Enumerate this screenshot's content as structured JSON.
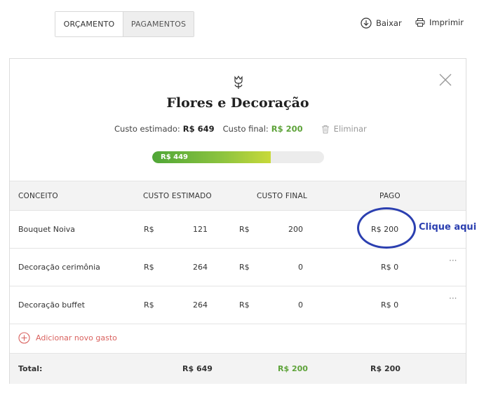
{
  "tabs": [
    {
      "label": "ORÇAMENTO",
      "active": true
    },
    {
      "label": "PAGAMENTOS",
      "active": false
    }
  ],
  "actions": {
    "download": "Baixar",
    "print": "Imprimir"
  },
  "category": {
    "title": "Flores e Decoração",
    "icon": "flower-icon",
    "estimated_label": "Custo estimado:",
    "estimated_value": "R$ 649",
    "final_label": "Custo final:",
    "final_value": "R$ 200",
    "delete_label": "Eliminar",
    "progress_label": "R$ 449",
    "progress_fraction": 0.69
  },
  "table": {
    "headers": [
      "CONCEITO",
      "CUSTO ESTIMADO",
      "CUSTO FINAL",
      "PAGO"
    ],
    "currency": "R$",
    "rows": [
      {
        "concept": "Bouquet Noiva",
        "estimated": "121",
        "final": "200",
        "paid": "R$ 200"
      },
      {
        "concept": "Decoração cerimônia",
        "estimated": "264",
        "final": "0",
        "paid": "R$ 0"
      },
      {
        "concept": "Decoração buffet",
        "estimated": "264",
        "final": "0",
        "paid": "R$ 0"
      }
    ],
    "add_label": "Adicionar novo gasto",
    "total_label": "Total:",
    "total_estimated": "R$ 649",
    "total_final": "R$ 200",
    "total_paid": "R$ 200"
  },
  "annotation": {
    "text": "Clique aqui"
  },
  "colors": {
    "accent_green": "#5ea33a",
    "accent_red": "#d9625f",
    "annotation_blue": "#2b3fb0"
  }
}
